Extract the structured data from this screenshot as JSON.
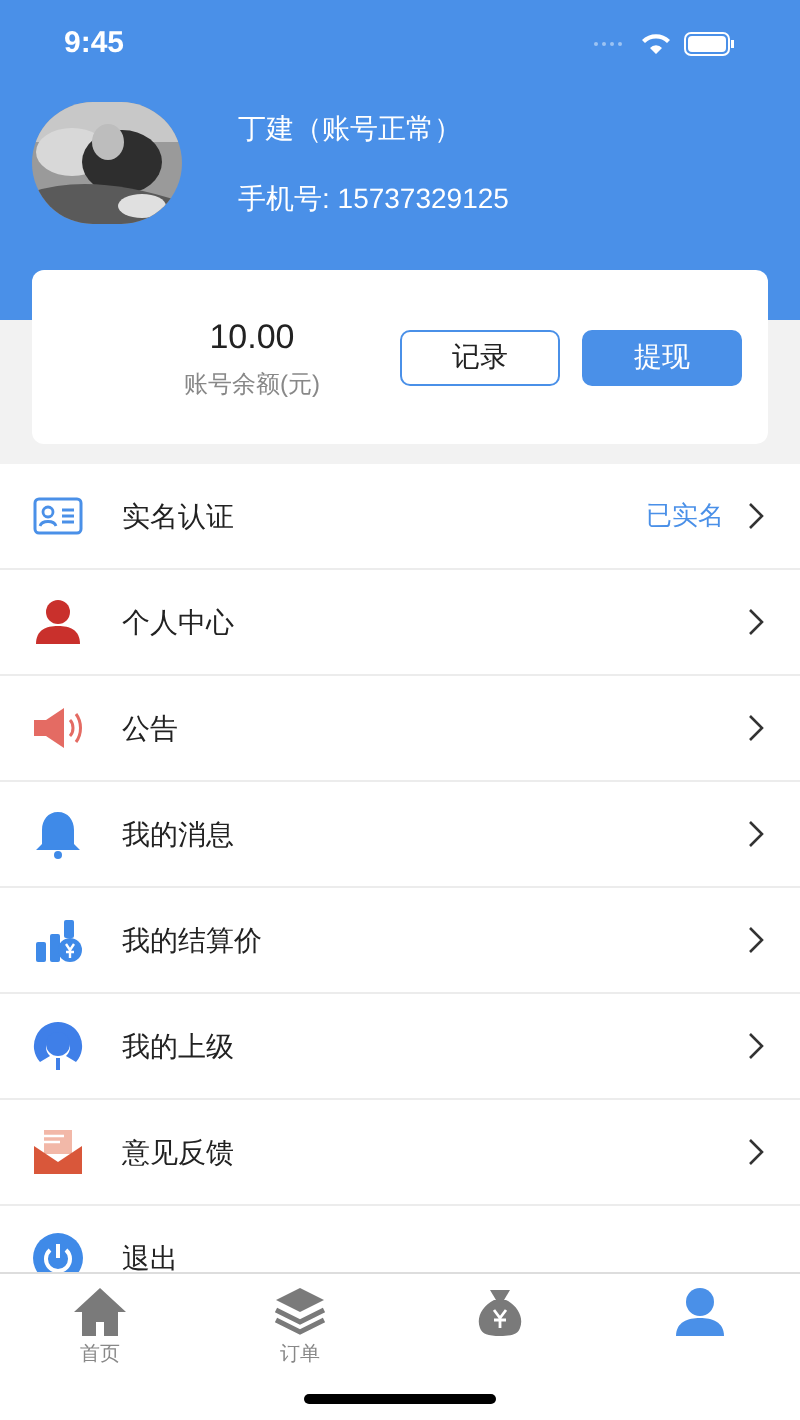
{
  "status_bar": {
    "time": "9:45"
  },
  "profile": {
    "name": "丁建（账号正常）",
    "phone": "手机号: 15737329125"
  },
  "balance": {
    "amount": "10.00",
    "label": "账号余额(元)",
    "buttons": [
      {
        "label": "记录",
        "kind": "outline"
      },
      {
        "label": "提现",
        "kind": "filled"
      }
    ]
  },
  "menu": [
    {
      "label": "实名认证",
      "value": "已实名",
      "arrow": true
    },
    {
      "label": "个人中心",
      "arrow": true
    },
    {
      "label": "公告",
      "arrow": true
    },
    {
      "label": "我的消息",
      "arrow": true
    },
    {
      "label": "我的结算价",
      "arrow": true
    },
    {
      "label": "我的上级",
      "arrow": true
    },
    {
      "label": "意见反馈",
      "arrow": true
    },
    {
      "label": "退出",
      "arrow": false
    }
  ],
  "tab_bar": [
    {
      "label": "首页",
      "selected": false
    },
    {
      "label": "订单",
      "selected": false
    },
    {
      "selected": false
    },
    {
      "selected": true
    }
  ]
}
